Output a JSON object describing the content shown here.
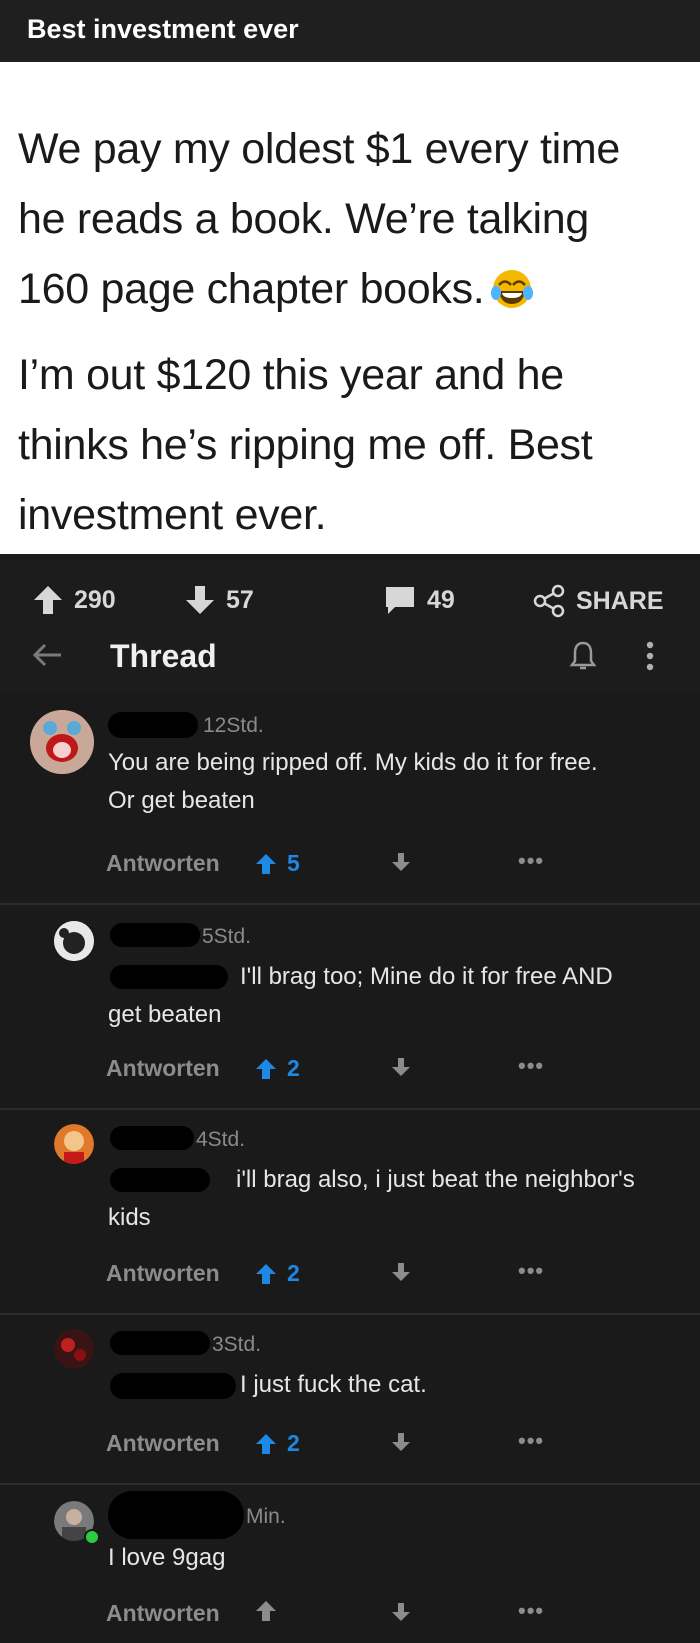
{
  "page": {
    "title": "Best investment ever"
  },
  "post": {
    "lines": [
      "We pay my oldest $1 every time",
      "he reads a book. We’re talking",
      "160 page chapter books.",
      "I’m out $120 this year and he",
      "thinks he’s ripping me off. Best",
      "investment ever."
    ],
    "emoji": "laughing-tears-emoji"
  },
  "actions": {
    "upvotes": "290",
    "downvotes": "57",
    "comments": "49",
    "share": "SHARE"
  },
  "thread": {
    "title": "Thread"
  },
  "comments": [
    {
      "time": "12Std.",
      "line1": "You are being ripped off. My kids do it for free.",
      "line2": "Or get beaten",
      "reply": "Antworten",
      "votes": "5",
      "more": "•••"
    },
    {
      "time": "5Std.",
      "line1": "I'll brag too; Mine do it for free AND",
      "line2": "get beaten",
      "reply": "Antworten",
      "votes": "2",
      "more": "•••"
    },
    {
      "time": "4Std.",
      "line1": "i'll brag also, i just beat the neighbor's",
      "line2": "kids",
      "reply": "Antworten",
      "votes": "2",
      "more": "•••"
    },
    {
      "time": "3Std.",
      "line1": "I just fuck the cat.",
      "reply": "Antworten",
      "votes": "2",
      "more": "•••"
    },
    {
      "time": "Min.",
      "line1": "I love 9gag",
      "reply": "Antworten",
      "votes": "",
      "more": "•••"
    }
  ],
  "colors": {
    "accent": "#1e88e5",
    "background": "#1a1a1a",
    "mention": "#3a7bd5"
  }
}
